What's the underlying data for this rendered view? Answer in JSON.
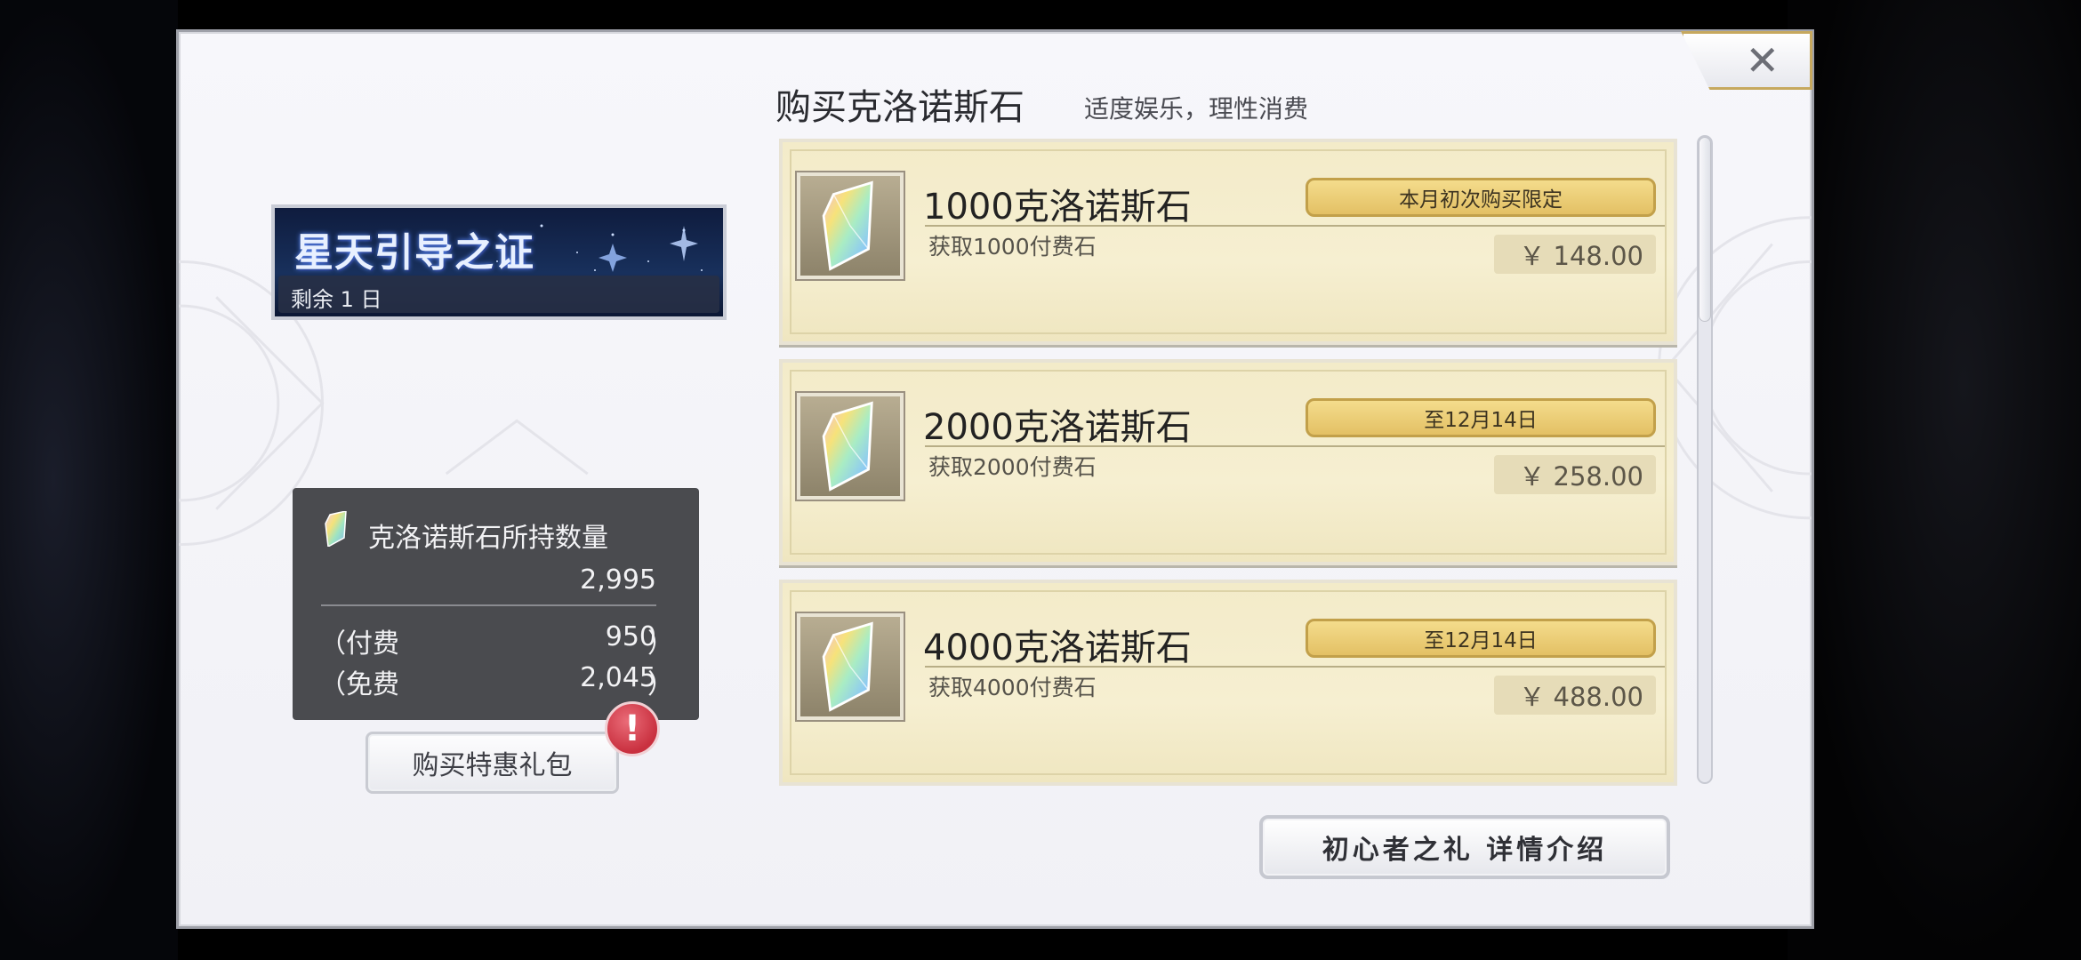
{
  "header": {
    "title": "购买克洛诺斯石",
    "subtitle": "适度娱乐，理性消费",
    "close_icon": "close-icon"
  },
  "banner": {
    "title": "星天引导之证",
    "remaining": "剩余 1 日"
  },
  "holdings": {
    "title": "克洛诺斯石所持数量",
    "total": "2,995",
    "paid_label": "（付费",
    "paid_value": "950",
    "free_label": "（免费",
    "free_value": "2,045",
    "close_paren": "）",
    "icon": "crystal-icon"
  },
  "gift_button": {
    "label": "购买特惠礼包",
    "alert": "!"
  },
  "products": [
    {
      "name": "1000克洛诺斯石",
      "desc": "获取1000付费石",
      "tag": "本月初次购买限定",
      "price": "￥ 148.00"
    },
    {
      "name": "2000克洛诺斯石",
      "desc": "获取2000付费石",
      "tag": "至12月14日",
      "price": "￥ 258.00"
    },
    {
      "name": "4000克洛诺斯石",
      "desc": "获取4000付费石",
      "tag": "至12月14日",
      "price": "￥ 488.00"
    }
  ],
  "detail_button": {
    "label": "初心者之礼 详情介绍"
  },
  "colors": {
    "card_bg": "#f3ebc9",
    "tag_gold": "#e3c064",
    "alert_red": "#c9303f"
  }
}
